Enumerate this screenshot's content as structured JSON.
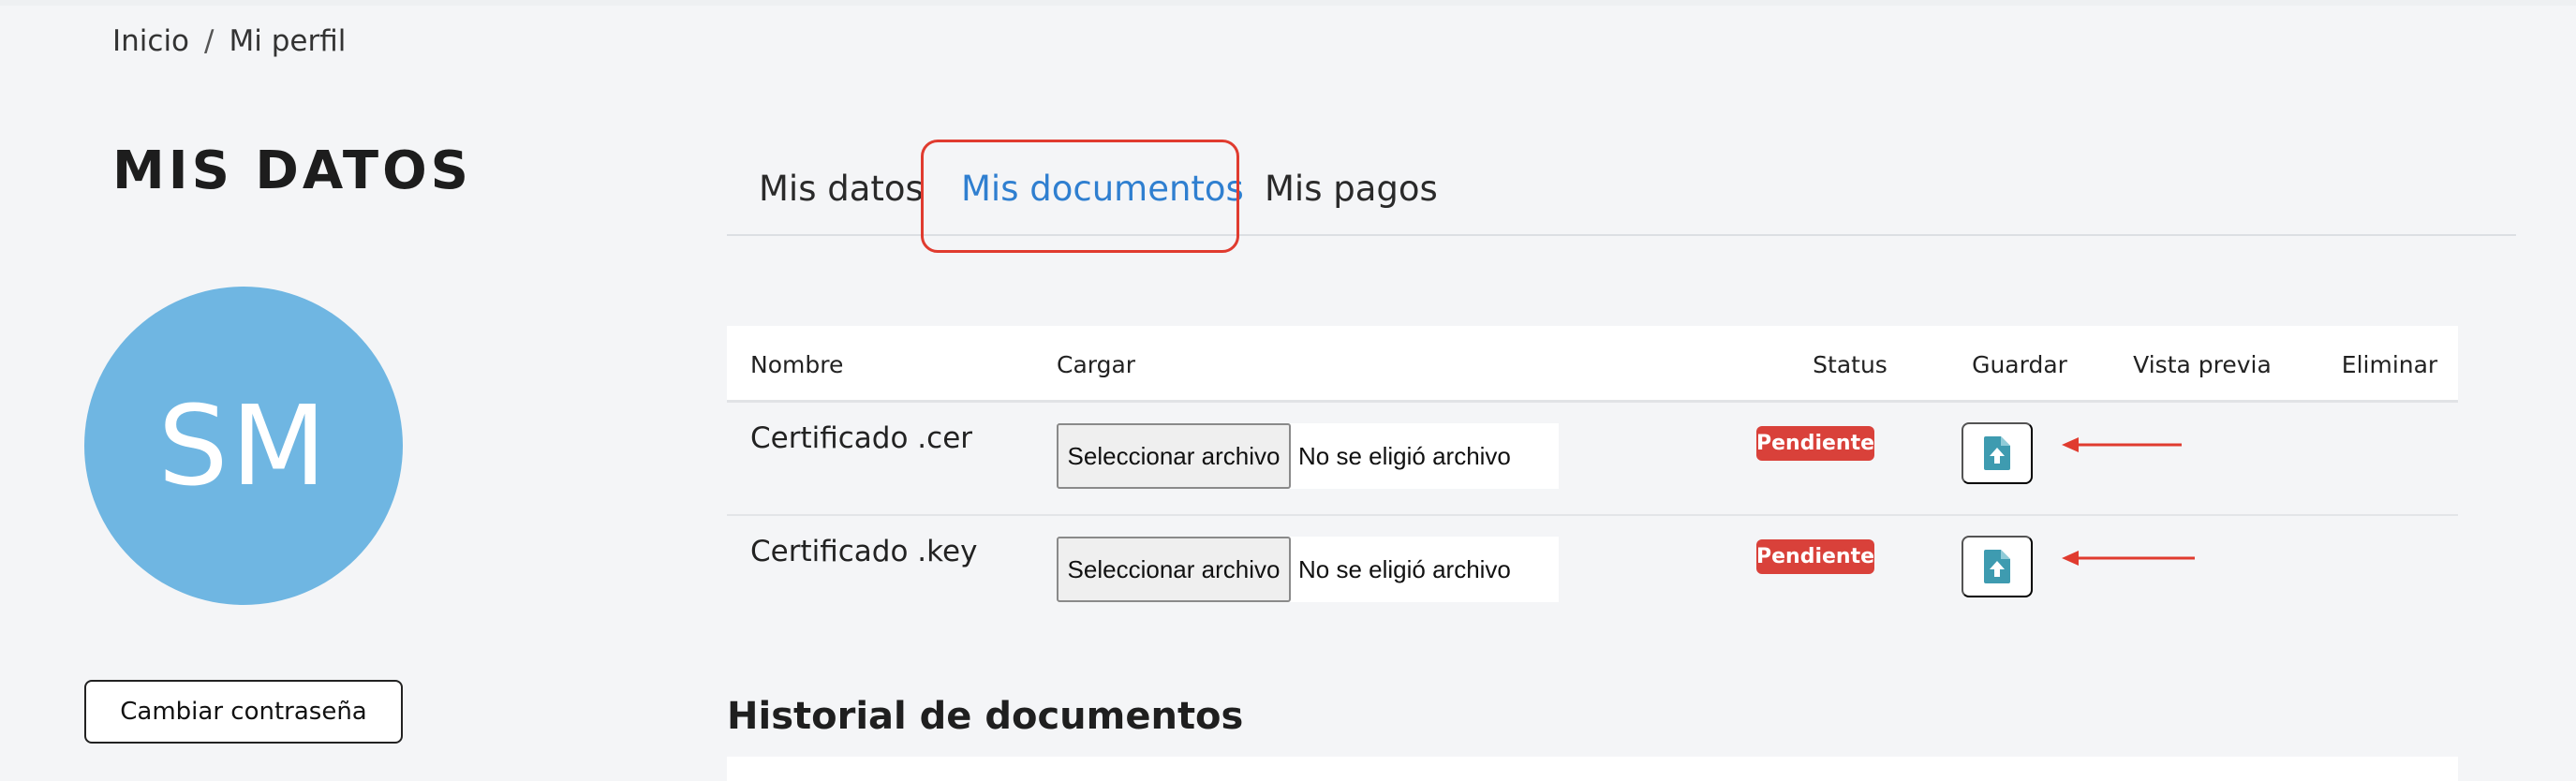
{
  "breadcrumb": {
    "home": "Inicio",
    "separator": "/",
    "current": "Mi perfil"
  },
  "page_title": "MIS DATOS",
  "avatar": {
    "initials": "SM",
    "color": "#6fb6e2"
  },
  "change_password_label": "Cambiar contraseña",
  "tabs": [
    {
      "label": "Mis datos",
      "active": false
    },
    {
      "label": "Mis documentos",
      "active": true
    },
    {
      "label": "Mis pagos",
      "active": false
    }
  ],
  "documents_table": {
    "headers": {
      "name": "Nombre",
      "upload": "Cargar",
      "status": "Status",
      "save": "Guardar",
      "preview": "Vista previa",
      "delete": "Eliminar"
    },
    "rows": [
      {
        "name": "Certificado .cer",
        "file_button": "Seleccionar archivo",
        "file_status": "No se eligió archivo",
        "status": "Pendiente",
        "save_icon": "file-upload-icon"
      },
      {
        "name": "Certificado .key",
        "file_button": "Seleccionar archivo",
        "file_status": "No se eligió archivo",
        "status": "Pendiente",
        "save_icon": "file-upload-icon"
      }
    ]
  },
  "history_title": "Historial de documentos",
  "colors": {
    "accent": "#2f7fd0",
    "status_pending": "#d9413a",
    "annotation": "#e03b2f",
    "icon": "#3e9bb0"
  }
}
